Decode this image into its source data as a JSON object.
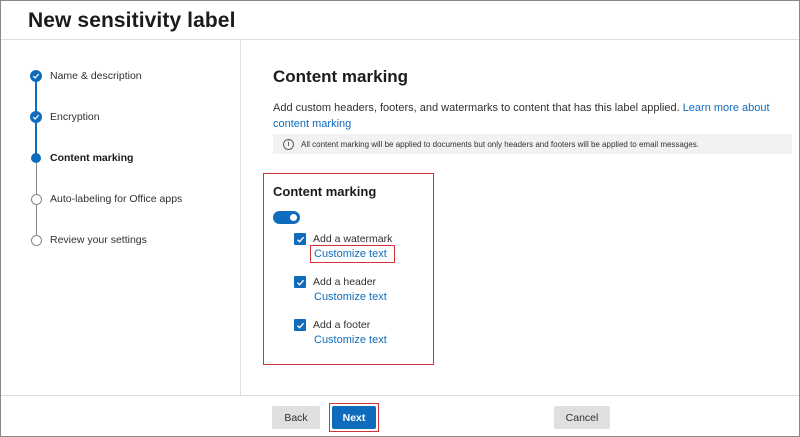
{
  "wizard": {
    "title": "New sensitivity label"
  },
  "steps": [
    {
      "label": "Name & description",
      "state": "done"
    },
    {
      "label": "Encryption",
      "state": "done"
    },
    {
      "label": "Content marking",
      "state": "current"
    },
    {
      "label": "Auto-labeling for Office apps",
      "state": "todo"
    },
    {
      "label": "Review your settings",
      "state": "todo"
    }
  ],
  "main": {
    "heading": "Content marking",
    "description": "Add custom headers, footers, and watermarks to content that has this label applied.",
    "learn_more": "Learn more about content marking",
    "info": "All content marking will be applied to documents but only headers and footers will be applied to email messages.",
    "section_title": "Content marking",
    "toggle_on": true,
    "options": [
      {
        "label": "Add a watermark",
        "checked": true,
        "link": "Customize text"
      },
      {
        "label": "Add a header",
        "checked": true,
        "link": "Customize text"
      },
      {
        "label": "Add a footer",
        "checked": true,
        "link": "Customize text"
      }
    ]
  },
  "footer": {
    "back": "Back",
    "next": "Next",
    "cancel": "Cancel"
  },
  "colors": {
    "accent": "#0f6cbd",
    "highlight": "#d13438"
  }
}
